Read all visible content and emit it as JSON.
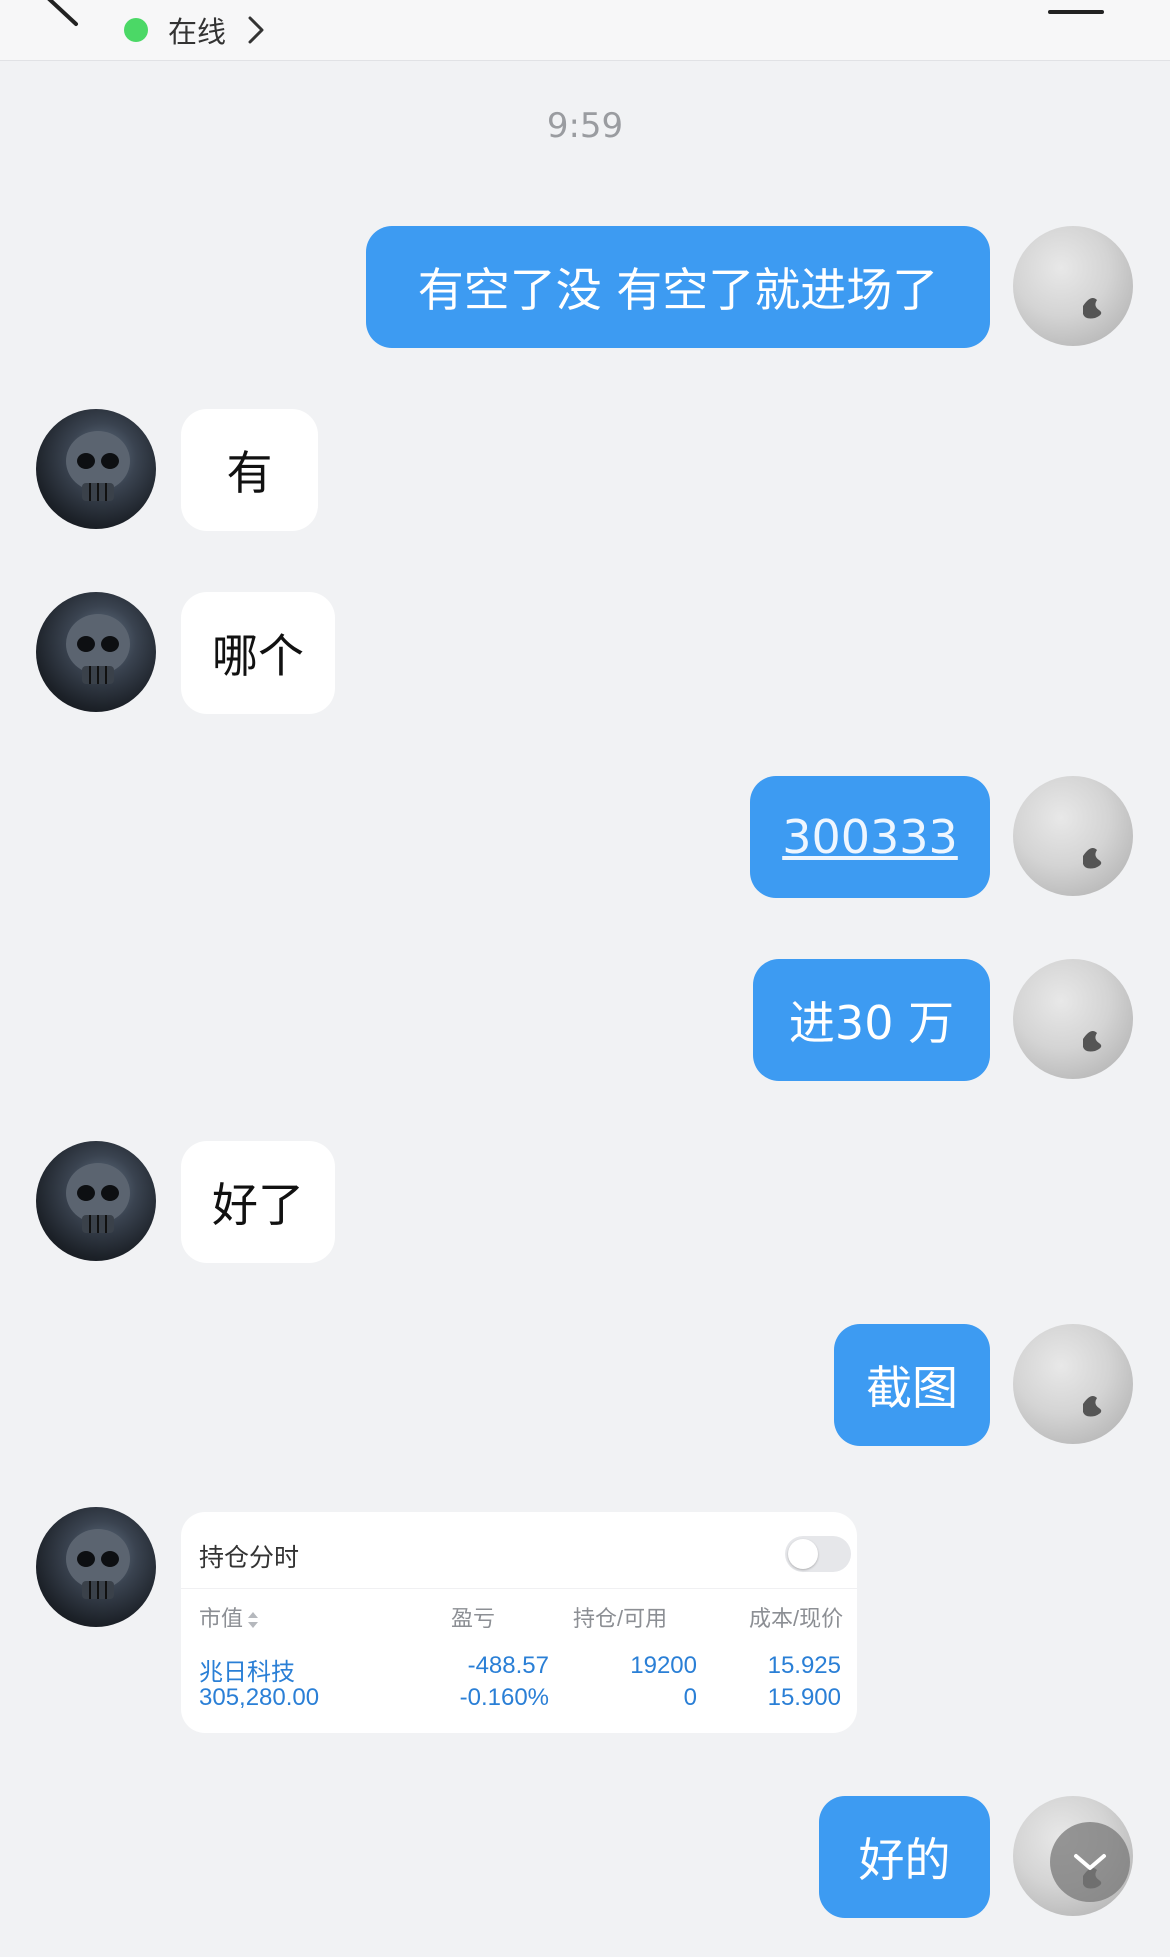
{
  "header": {
    "status_text": "在线"
  },
  "time_stamp": "9:59",
  "messages": [
    {
      "sender": "self",
      "text": "有空了没 有空了就进场了"
    },
    {
      "sender": "other",
      "text": "有"
    },
    {
      "sender": "other",
      "text": "哪个"
    },
    {
      "sender": "self",
      "text": "300333"
    },
    {
      "sender": "self",
      "text": "进30 万"
    },
    {
      "sender": "other",
      "text": "好了"
    },
    {
      "sender": "self",
      "text": "截图"
    },
    {
      "sender": "self",
      "text": "好的"
    }
  ],
  "position_card": {
    "title": "持仓分时",
    "columns": [
      "市值",
      "盈亏",
      "持仓/可用",
      "成本/现价"
    ],
    "row": {
      "name": "兆日科技",
      "market_value": "305,280.00",
      "pnl": "-488.57",
      "pnl_pct": "-0.160%",
      "holding": "19200",
      "available": "0",
      "cost": "15.925",
      "price": "15.900"
    }
  },
  "colors": {
    "self_bubble": "#3d9bf2",
    "other_bubble": "#ffffff",
    "online": "#4bd866",
    "background": "#f1f2f4",
    "stock_text": "#2a7fd6"
  },
  "icons": [
    "back-arrow-icon",
    "chevron-right-icon",
    "menu-icon",
    "chevron-down-icon",
    "sort-icon"
  ]
}
